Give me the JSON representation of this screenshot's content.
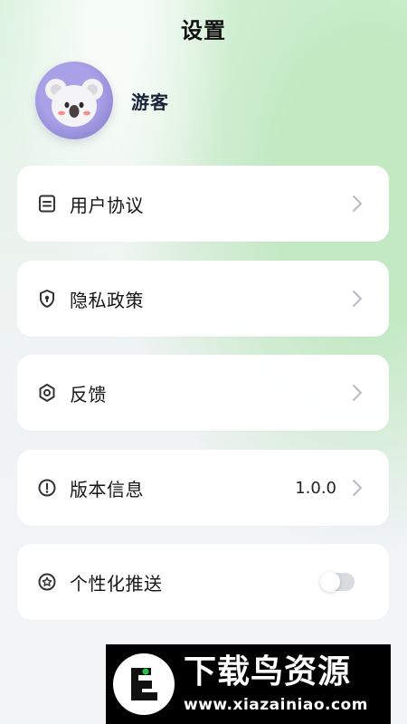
{
  "header": {
    "title": "设置"
  },
  "profile": {
    "avatar_icon": "koala-avatar-icon",
    "name": "游客"
  },
  "menu": {
    "items": [
      {
        "label": "用户协议",
        "icon": "document-icon",
        "right_icon": "chevron-right-icon"
      },
      {
        "label": "隐私政策",
        "icon": "shield-icon",
        "right_icon": "chevron-right-icon"
      },
      {
        "label": "反馈",
        "icon": "hexagon-icon",
        "right_icon": "chevron-right-icon"
      },
      {
        "label": "版本信息",
        "icon": "info-icon",
        "value": "1.0.0",
        "right_icon": "chevron-right-icon"
      },
      {
        "label": "个性化推送",
        "icon": "star-icon",
        "toggle_state": "off"
      }
    ]
  },
  "watermark": {
    "title": "下载鸟资源",
    "subtitle": "www.xiazainiao.com"
  },
  "colors": {
    "accent_green": "#dff3e1",
    "card_background": "#ffffff",
    "chevron": "#b8bbc2",
    "toggle_track": "#d8dbe0",
    "avatar_purple": "#9a93da"
  }
}
